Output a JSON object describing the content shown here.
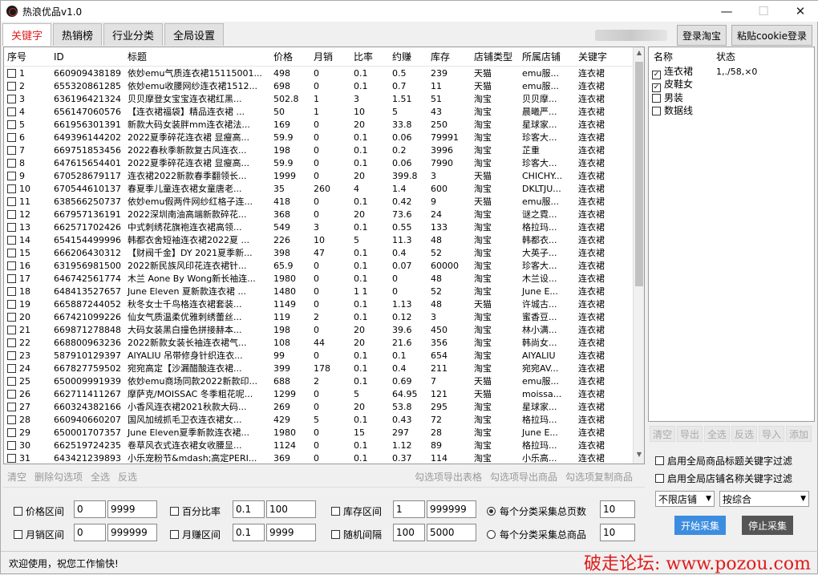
{
  "window": {
    "title": "热浪优品v1.0",
    "min": "—",
    "max": "☐",
    "close": "✕"
  },
  "tabs": [
    {
      "label": "关键字"
    },
    {
      "label": "热销榜"
    },
    {
      "label": "行业分类"
    },
    {
      "label": "全局设置"
    }
  ],
  "header": {
    "login_taobao": "登录淘宝",
    "paste_cookie": "粘贴cookie登录"
  },
  "table": {
    "columns": [
      "序号",
      "ID",
      "标题",
      "价格",
      "月销",
      "比率",
      "约赚",
      "库存",
      "店铺类型",
      "所属店铺",
      "关键字"
    ],
    "rows": [
      [
        "1",
        "660909438189",
        "依妙emu气质连衣裙15115001...",
        "498",
        "0",
        "0.1",
        "0.5",
        "239",
        "天猫",
        "emu服...",
        "连衣裙"
      ],
      [
        "2",
        "655320861285",
        "依妙emu收腰网纱连衣裙1512...",
        "698",
        "0",
        "0.1",
        "0.7",
        "11",
        "天猫",
        "emu服...",
        "连衣裙"
      ],
      [
        "3",
        "636196421324",
        "贝贝摩登女宝宝连衣裙红黑...",
        "502.8",
        "1",
        "3",
        "1.51",
        "51",
        "淘宝",
        "贝贝摩...",
        "连衣裙"
      ],
      [
        "4",
        "656147060576",
        "【连衣裙福袋】精品连衣裙 ...",
        "50",
        "1",
        "10",
        "5",
        "43",
        "淘宝",
        "晨曦严...",
        "连衣裙"
      ],
      [
        "5",
        "661956301391",
        "新款大码女装胖mm连衣裙法...",
        "169",
        "0",
        "20",
        "33.8",
        "250",
        "淘宝",
        "星球家...",
        "连衣裙"
      ],
      [
        "6",
        "649396144202",
        "2022夏季碎花连衣裙 显瘦高...",
        "59.9",
        "0",
        "0.1",
        "0.06",
        "79991",
        "淘宝",
        "珍客大...",
        "连衣裙"
      ],
      [
        "7",
        "669751853456",
        "2022春秋季新款复古风连衣...",
        "198",
        "0",
        "0.1",
        "0.2",
        "3996",
        "淘宝",
        "芷重",
        "连衣裙"
      ],
      [
        "8",
        "647615654401",
        "2022夏季碎花连衣裙 显瘦高...",
        "59.9",
        "0",
        "0.1",
        "0.06",
        "7990",
        "淘宝",
        "珍客大...",
        "连衣裙"
      ],
      [
        "9",
        "670528679117",
        "连衣裙2022新款春季翻领长...",
        "1999",
        "0",
        "20",
        "399.8",
        "3",
        "天猫",
        "CHICHY...",
        "连衣裙"
      ],
      [
        "10",
        "670544610137",
        "春夏季儿童连衣裙女童唐老...",
        "35",
        "260",
        "4",
        "1.4",
        "600",
        "淘宝",
        "DKLTJU...",
        "连衣裙"
      ],
      [
        "11",
        "638566250737",
        "依妙emu假两件网纱红格子连...",
        "418",
        "0",
        "0.1",
        "0.42",
        "9",
        "天猫",
        "emu服...",
        "连衣裙"
      ],
      [
        "12",
        "667957136191",
        "2022深圳南油高端新款碎花...",
        "368",
        "0",
        "20",
        "73.6",
        "24",
        "淘宝",
        "谜之霓...",
        "连衣裙"
      ],
      [
        "13",
        "662571702426",
        "中式刺绣花旗袍连衣裙高领...",
        "549",
        "3",
        "0.1",
        "0.55",
        "133",
        "淘宝",
        "格拉玛...",
        "连衣裙"
      ],
      [
        "14",
        "654154499996",
        "韩都衣舍短袖连衣裙2022夏 ...",
        "226",
        "10",
        "5",
        "11.3",
        "48",
        "淘宝",
        "韩都衣...",
        "连衣裙"
      ],
      [
        "15",
        "666206430312",
        "【财阀千金】DY 2021夏季新...",
        "398",
        "47",
        "0.1",
        "0.4",
        "52",
        "淘宝",
        "大英子...",
        "连衣裙"
      ],
      [
        "16",
        "631956981500",
        "2022新民族风印花连衣裙针...",
        "65.9",
        "0",
        "0.1",
        "0.07",
        "60000",
        "淘宝",
        "珍客大...",
        "连衣裙"
      ],
      [
        "17",
        "646742561774",
        "木兰 Aone By Wong新长袖连...",
        "1980",
        "0",
        "0.1",
        "0",
        "48",
        "淘宝",
        "木兰设...",
        "连衣裙"
      ],
      [
        "18",
        "648413527657",
        "June Eleven 夏新款连衣裙 ...",
        "1480",
        "0",
        "1 1",
        "0",
        "52",
        "淘宝",
        "June E...",
        "连衣裙"
      ],
      [
        "19",
        "665887244052",
        "秋冬女士千鸟格连衣裙套装...",
        "1149",
        "0",
        "0.1",
        "1.13",
        "48",
        "天猫",
        "许城古...",
        "连衣裙"
      ],
      [
        "20",
        "667421099226",
        "仙女气质温柔优雅刺绣蕾丝...",
        "119",
        "2",
        "0.1",
        "0.12",
        "3",
        "淘宝",
        "蜜香豆...",
        "连衣裙"
      ],
      [
        "21",
        "669871278848",
        "大码女装黑白撞色拼接赫本...",
        "198",
        "0",
        "20",
        "39.6",
        "450",
        "淘宝",
        "林小满...",
        "连衣裙"
      ],
      [
        "22",
        "668800963236",
        "2022新款女装长袖连衣裙气...",
        "108",
        "44",
        "20",
        "21.6",
        "356",
        "淘宝",
        "韩尚女...",
        "连衣裙"
      ],
      [
        "23",
        "587910129397",
        "AIYALIU 吊带修身针织连衣...",
        "99",
        "0",
        "0.1",
        "0.1",
        "654",
        "淘宝",
        "AIYALIU",
        "连衣裙"
      ],
      [
        "24",
        "667827759502",
        "宛宛高定【沙漏醋酸连衣裙...",
        "399",
        "178",
        "0.1",
        "0.4",
        "211",
        "淘宝",
        "宛宛AV...",
        "连衣裙"
      ],
      [
        "25",
        "650009991939",
        "依妙emu商场同款2022新款印...",
        "688",
        "2",
        "0.1",
        "0.69",
        "7",
        "天猫",
        "emu服...",
        "连衣裙"
      ],
      [
        "26",
        "662711411267",
        "摩萨克/MOISSAC 冬季粗花呢...",
        "1299",
        "0",
        "5",
        "64.95",
        "121",
        "天猫",
        "moissa...",
        "连衣裙"
      ],
      [
        "27",
        "660324382166",
        "小香风连衣裙2021秋款大码...",
        "269",
        "0",
        "20",
        "53.8",
        "295",
        "淘宝",
        "星球家...",
        "连衣裙"
      ],
      [
        "28",
        "660940660207",
        "国风加绒抓毛卫衣连衣裙女...",
        "429",
        "5",
        "0.1",
        "0.43",
        "72",
        "淘宝",
        "格拉玛...",
        "连衣裙"
      ],
      [
        "29",
        "650001707357",
        "June Eleven夏季新款连衣裙...",
        "1980",
        "0",
        "15",
        "297",
        "28",
        "淘宝",
        "June E...",
        "连衣裙"
      ],
      [
        "30",
        "662519724235",
        "卷草风衣式连衣裙女收腰显...",
        "1124",
        "0",
        "0.1",
        "1.12",
        "89",
        "淘宝",
        "格拉玛...",
        "连衣裙"
      ],
      [
        "31",
        "643421239893",
        "小乐宠粉节&mdash;高定PERI...",
        "369",
        "0",
        "0.1",
        "0.37",
        "114",
        "淘宝",
        "小乐高...",
        "连衣裙"
      ]
    ]
  },
  "right_panel": {
    "columns": [
      "名称",
      "状态"
    ],
    "rows": [
      {
        "name": "连衣裙",
        "status": "1,./58,×0",
        "checked": true
      },
      {
        "name": "皮鞋女",
        "status": "",
        "checked": true
      },
      {
        "name": "男装",
        "status": "",
        "checked": false
      },
      {
        "name": "数据线",
        "status": "",
        "checked": false
      }
    ],
    "buttons": [
      "清空",
      "导出",
      "全选",
      "反选",
      "导入",
      "添加"
    ]
  },
  "left_actions": [
    "清空",
    "删除勾选项",
    "全选",
    "反选"
  ],
  "export_actions": [
    "勾选项导出表格",
    "勾选项导出商品",
    "勾选项复制商品"
  ],
  "filters": {
    "price": {
      "label": "价格区间",
      "min": "0",
      "max": "9999"
    },
    "percent": {
      "label": "百分比率",
      "min": "0.1",
      "max": "100"
    },
    "stock": {
      "label": "库存区间",
      "min": "1",
      "max": "999999"
    },
    "monthly": {
      "label": "月销区间",
      "min": "0",
      "max": "999999"
    },
    "earn": {
      "label": "月赚区间",
      "min": "0.1",
      "max": "9999"
    },
    "interval": {
      "label": "随机间隔",
      "min": "100",
      "max": "5000"
    },
    "pages_radio": {
      "label": "每个分类采集总页数",
      "value": "10"
    },
    "goods_radio": {
      "label": "每个分类采集总商品",
      "value": "10"
    }
  },
  "options": {
    "title_filter": "启用全局商品标题关键字过滤",
    "shop_filter": "启用全局店铺名称关键字过滤",
    "shop_select": "不限店铺",
    "sort_select": "按综合"
  },
  "actions": {
    "start": "开始采集",
    "stop": "停止采集"
  },
  "status": {
    "text": "欢迎使用，祝您工作愉快!"
  },
  "watermark": "破走论坛: www.pozou.com",
  "colors": {
    "active_tab": "#e02020",
    "start_btn": "#3c8de0",
    "stop_btn": "#555555"
  }
}
